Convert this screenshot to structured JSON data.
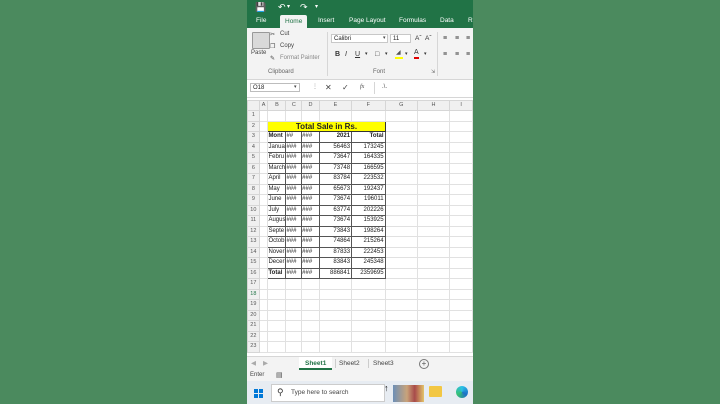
{
  "ribbon_tabs": [
    "File",
    "Home",
    "Insert",
    "Page Layout",
    "Formulas",
    "Data",
    "R"
  ],
  "active_tab": "Home",
  "clipboard": {
    "paste": "Paste",
    "cut": "Cut",
    "copy": "Copy",
    "format_painter": "Format Painter",
    "group": "Clipboard"
  },
  "font": {
    "name": "Calibri",
    "size": "11",
    "group": "Font",
    "bold": "B",
    "italic": "I",
    "underline": "U"
  },
  "name_box": "O18",
  "formula_value": ".\\.",
  "fx": "fx",
  "columns": [
    "A",
    "B",
    "C",
    "D",
    "E",
    "F",
    "G",
    "H",
    "I"
  ],
  "title_text": "Total Sale in Rs.",
  "header": [
    "Mont",
    "##",
    "###",
    "2021",
    "Total"
  ],
  "rows": [
    [
      "Janua",
      "###",
      "###",
      "56463",
      "173245"
    ],
    [
      "Febru",
      "###",
      "###",
      "73647",
      "164335"
    ],
    [
      "March",
      "###",
      "###",
      "73748",
      "166595"
    ],
    [
      "April",
      "###",
      "###",
      "83784",
      "223532"
    ],
    [
      "May",
      "###",
      "###",
      "65673",
      "192437"
    ],
    [
      "June",
      "###",
      "###",
      "73674",
      "196011"
    ],
    [
      "July",
      "###",
      "###",
      "63774",
      "202226"
    ],
    [
      "Augus",
      "###",
      "###",
      "73674",
      "153925"
    ],
    [
      "Septe",
      "###",
      "###",
      "73843",
      "198264"
    ],
    [
      "Octob",
      "###",
      "###",
      "74864",
      "215264"
    ],
    [
      "Nover",
      "###",
      "###",
      "87833",
      "222453"
    ],
    [
      "Decer",
      "###",
      "###",
      "83843",
      "245348"
    ]
  ],
  "total_row": [
    "Total",
    "###",
    "###",
    "886841",
    "2359695"
  ],
  "row_numbers": [
    "1",
    "2",
    "3",
    "4",
    "5",
    "6",
    "7",
    "8",
    "9",
    "10",
    "11",
    "12",
    "13",
    "14",
    "15",
    "16",
    "17",
    "18",
    "19",
    "20",
    "21",
    "22",
    "23"
  ],
  "sheet_tabs": [
    "Sheet1",
    "Sheet2",
    "Sheet3"
  ],
  "active_sheet": "Sheet1",
  "status_text": "Enter",
  "search_placeholder": "Type here to search",
  "colors": {
    "excel_green": "#217346",
    "highlight_yellow": "#ffff00",
    "background": "#4b8a5e"
  }
}
